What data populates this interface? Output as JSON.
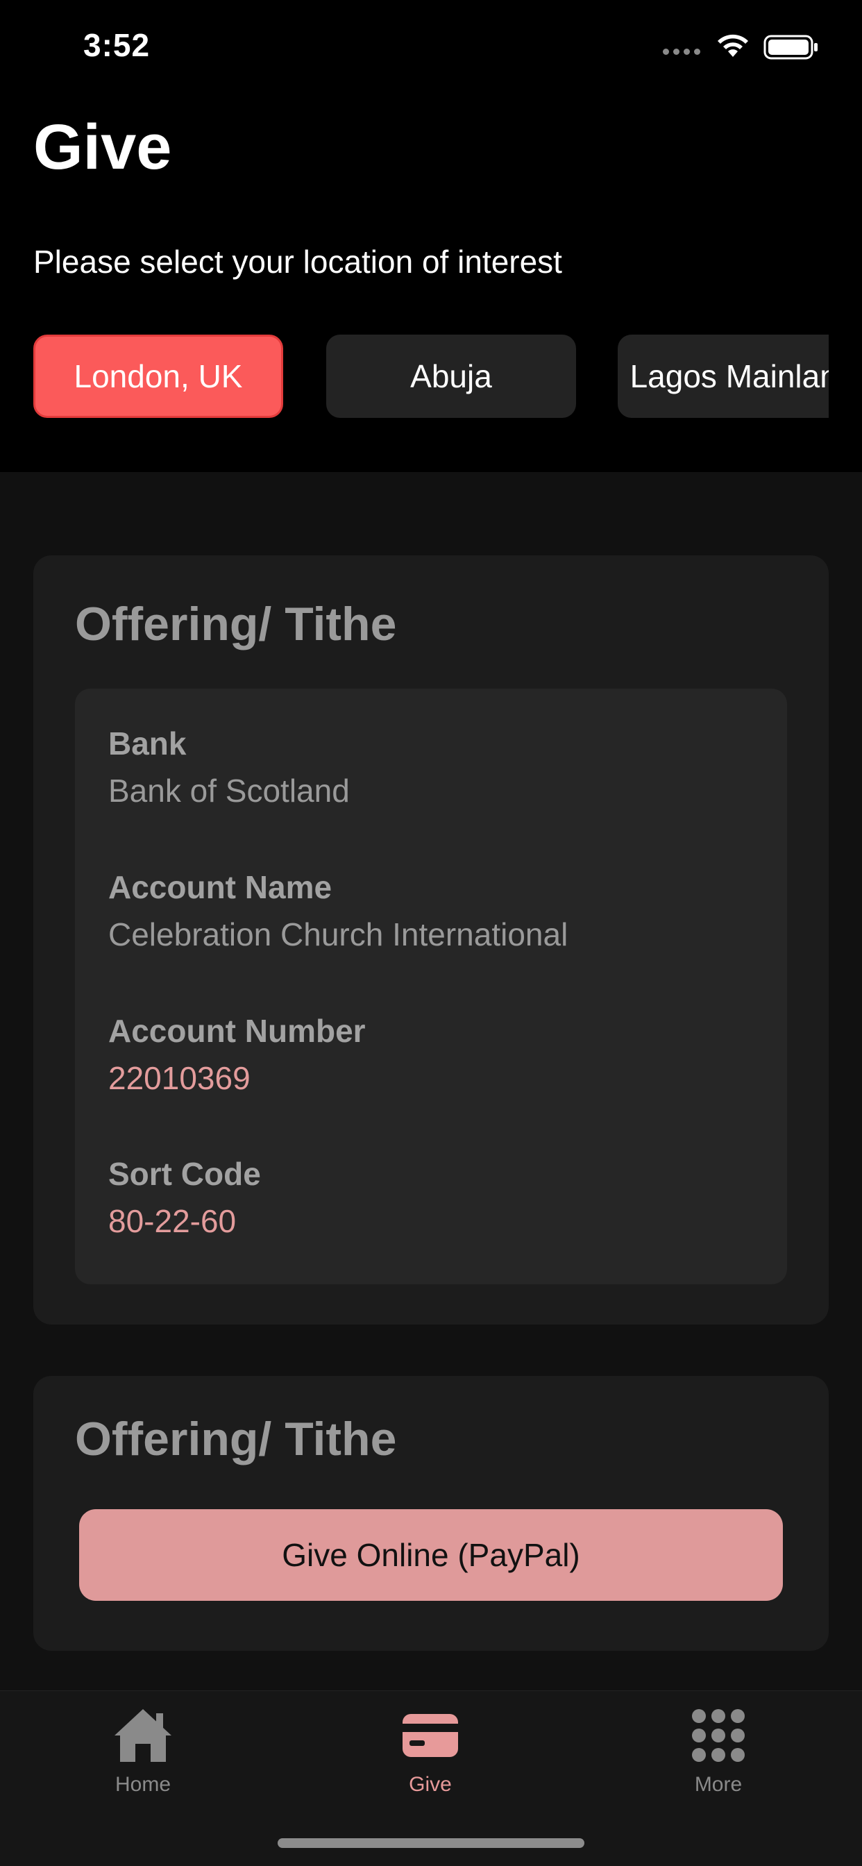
{
  "status_bar": {
    "time": "3:52"
  },
  "header": {
    "title": "Give",
    "subtitle": "Please select your location of interest"
  },
  "locations": [
    {
      "label": "London, UK",
      "selected": true
    },
    {
      "label": "Abuja",
      "selected": false
    },
    {
      "label": "Lagos Mainland",
      "selected": false
    }
  ],
  "bank_card": {
    "title": "Offering/ Tithe",
    "fields": [
      {
        "label": "Bank",
        "value": "Bank of Scotland"
      },
      {
        "label": "Account Name",
        "value": "Celebration Church International"
      },
      {
        "label": "Account Number",
        "value": "22010369"
      },
      {
        "label": "Sort Code",
        "value": "80-22-60"
      }
    ]
  },
  "online_card": {
    "title": "Offering/ Tithe",
    "button_label": "Give Online (PayPal)"
  },
  "tab_bar": {
    "items": [
      {
        "label": "Home",
        "icon": "home-icon",
        "active": false
      },
      {
        "label": "Give",
        "icon": "card-icon",
        "active": true
      },
      {
        "label": "More",
        "icon": "grid-icon",
        "active": false
      }
    ]
  },
  "colors": {
    "accent": "#fb5a5a",
    "accent_soft": "#df9a9a",
    "value_accent": "#e39c9c",
    "background": "#000000",
    "card": "#1c1c1c"
  }
}
